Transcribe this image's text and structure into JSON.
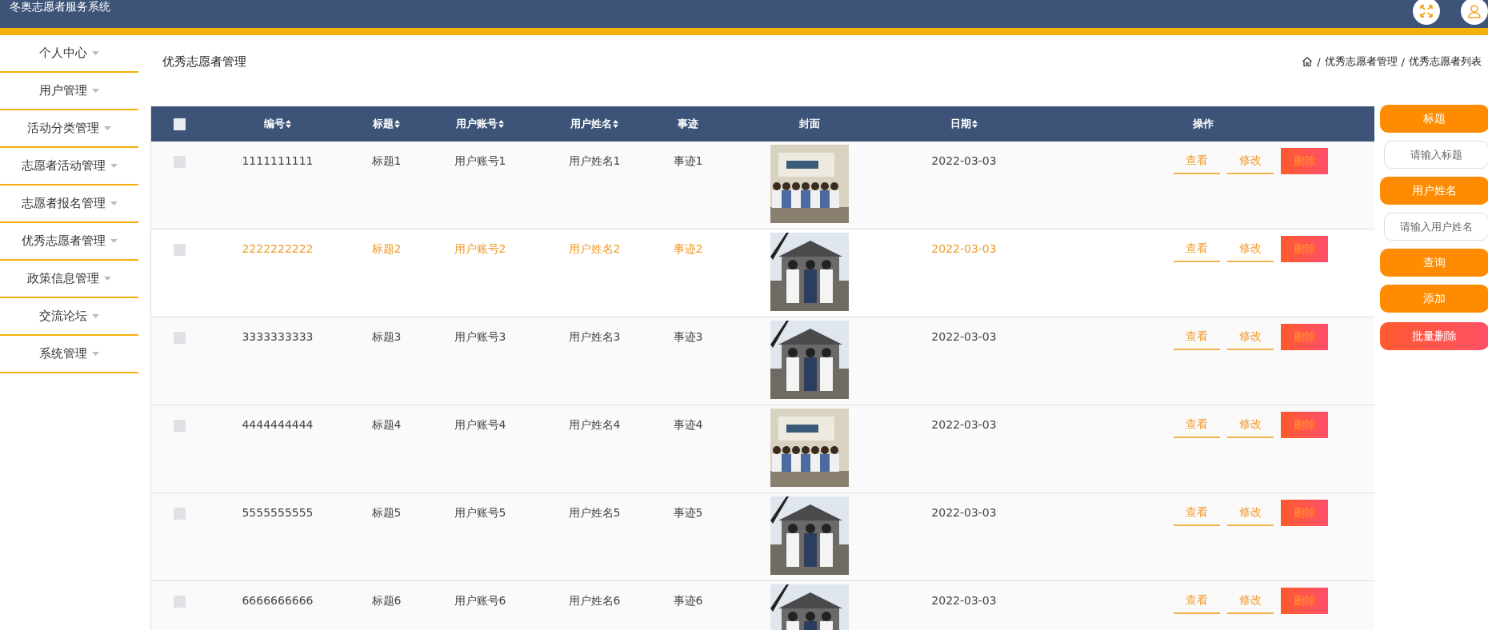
{
  "app_title": "冬奥志愿者服务系统",
  "sidebar": {
    "items": [
      {
        "label": "个人中心"
      },
      {
        "label": "用户管理"
      },
      {
        "label": "活动分类管理"
      },
      {
        "label": "志愿者活动管理"
      },
      {
        "label": "志愿者报名管理"
      },
      {
        "label": "优秀志愿者管理"
      },
      {
        "label": "政策信息管理"
      },
      {
        "label": "交流论坛"
      },
      {
        "label": "系统管理"
      }
    ]
  },
  "page_title": "优秀志愿者管理",
  "breadcrumb": [
    {
      "separator": "/",
      "label": "优秀志愿者管理"
    },
    {
      "separator": "/",
      "label": "优秀志愿者列表"
    }
  ],
  "table": {
    "select_all_checked": false,
    "columns": [
      {
        "label": "编号",
        "sortable": true
      },
      {
        "label": "标题",
        "sortable": true
      },
      {
        "label": "用户账号",
        "sortable": true
      },
      {
        "label": "用户姓名",
        "sortable": true
      },
      {
        "label": "事迹",
        "sortable": false
      },
      {
        "label": "封面",
        "sortable": false
      },
      {
        "label": "日期",
        "sortable": true
      },
      {
        "label": "操作",
        "sortable": false
      }
    ],
    "rows": [
      {
        "id": "1111111111",
        "title": "标题1",
        "account": "用户账号1",
        "name": "用户姓名1",
        "deed": "事迹1",
        "date": "2022-03-03",
        "highlighted": false,
        "actions": [
          "查看",
          "修改",
          "删除"
        ]
      },
      {
        "id": "2222222222",
        "title": "标题2",
        "account": "用户账号2",
        "name": "用户姓名2",
        "deed": "事迹2",
        "date": "2022-03-03",
        "highlighted": true,
        "actions": [
          "查看",
          "修改",
          "删除"
        ]
      },
      {
        "id": "3333333333",
        "title": "标题3",
        "account": "用户账号3",
        "name": "用户姓名3",
        "deed": "事迹3",
        "date": "2022-03-03",
        "highlighted": false,
        "actions": [
          "查看",
          "修改",
          "删除"
        ]
      },
      {
        "id": "4444444444",
        "title": "标题4",
        "account": "用户账号4",
        "name": "用户姓名4",
        "deed": "事迹4",
        "date": "2022-03-03",
        "highlighted": false,
        "actions": [
          "查看",
          "修改",
          "删除"
        ]
      },
      {
        "id": "5555555555",
        "title": "标题5",
        "account": "用户账号5",
        "name": "用户姓名5",
        "deed": "事迹5",
        "date": "2022-03-03",
        "highlighted": false,
        "actions": [
          "查看",
          "修改",
          "删除"
        ]
      },
      {
        "id": "6666666666",
        "title": "标题6",
        "account": "用户账号6",
        "name": "用户姓名6",
        "deed": "事迹6",
        "date": "2022-03-03",
        "highlighted": false,
        "actions": [
          "查看",
          "修改",
          "删除"
        ]
      }
    ]
  },
  "search_panel": [
    {
      "kind": "label",
      "text": "标题"
    },
    {
      "kind": "input",
      "placeholder": "请输入标题"
    },
    {
      "kind": "label",
      "text": "用户姓名"
    },
    {
      "kind": "input",
      "placeholder": "请输入用户姓名"
    },
    {
      "kind": "button",
      "text": "查询"
    },
    {
      "kind": "button",
      "text": "添加"
    },
    {
      "kind": "danger",
      "text": "批量删除"
    }
  ]
}
